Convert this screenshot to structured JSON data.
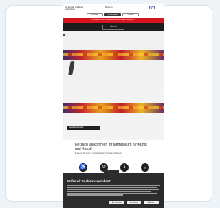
{
  "header": {
    "org_name": "Die Zentrale des Banks ist Schlüssel",
    "top_link": "Museum",
    "logo_text": "IVR"
  },
  "tabs": [
    {
      "label": "Besuchen",
      "active": false
    },
    {
      "label": "Ausstellungen",
      "active": true
    },
    {
      "label": "Kalender",
      "active": false
    }
  ],
  "alert_text": "Informationen über Museumsbesuch am Ostermontag gelten",
  "nav_button": "Übersicht",
  "hero_caption": "Ausstellungsansicht",
  "content": {
    "heading": "Herzlich willkommen im Mitmuseum für Kunst und Kunst!",
    "subtext": "Entdecken Sie Kunst in unterschiedlichen Formaten im Museum."
  },
  "icons": [
    "accessibility-icon",
    "no-entry-icon",
    "info-icon",
    "person-icon"
  ],
  "cookie": {
    "title": "Dürfen wir Cookies verwenden?",
    "buttons": [
      "Alle akzeptieren",
      "Einstellungen",
      "Ablehnen"
    ]
  },
  "colors": {
    "alert": "#d8141f",
    "dark": "#2c2c2c",
    "logo": "#1a3d8a"
  }
}
